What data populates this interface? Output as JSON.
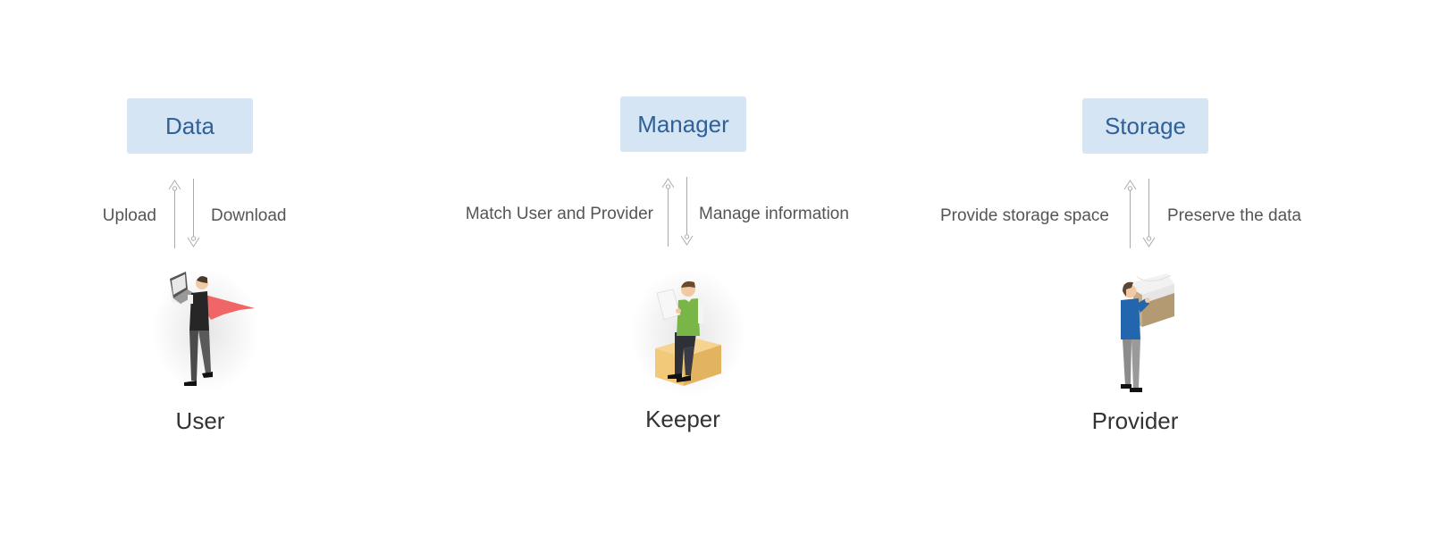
{
  "columns": [
    {
      "box_label": "Data",
      "up_label": "Upload",
      "down_label": "Download",
      "role_label": "User",
      "figure_icon": "superhero-user-with-laptop-icon"
    },
    {
      "box_label": "Manager",
      "up_label": "Match User and Provider",
      "down_label": "Manage information",
      "role_label": "Keeper",
      "figure_icon": "keeper-reading-on-box-icon"
    },
    {
      "box_label": "Storage",
      "up_label": "Provide storage space",
      "down_label": "Preserve the data",
      "role_label": "Provider",
      "figure_icon": "provider-carrying-box-icon"
    }
  ],
  "colors": {
    "box_fill": "#d6e5f4",
    "box_text": "#2f6198",
    "label_text": "#555555",
    "role_text": "#333333",
    "arrow": "#aaaaaa"
  }
}
